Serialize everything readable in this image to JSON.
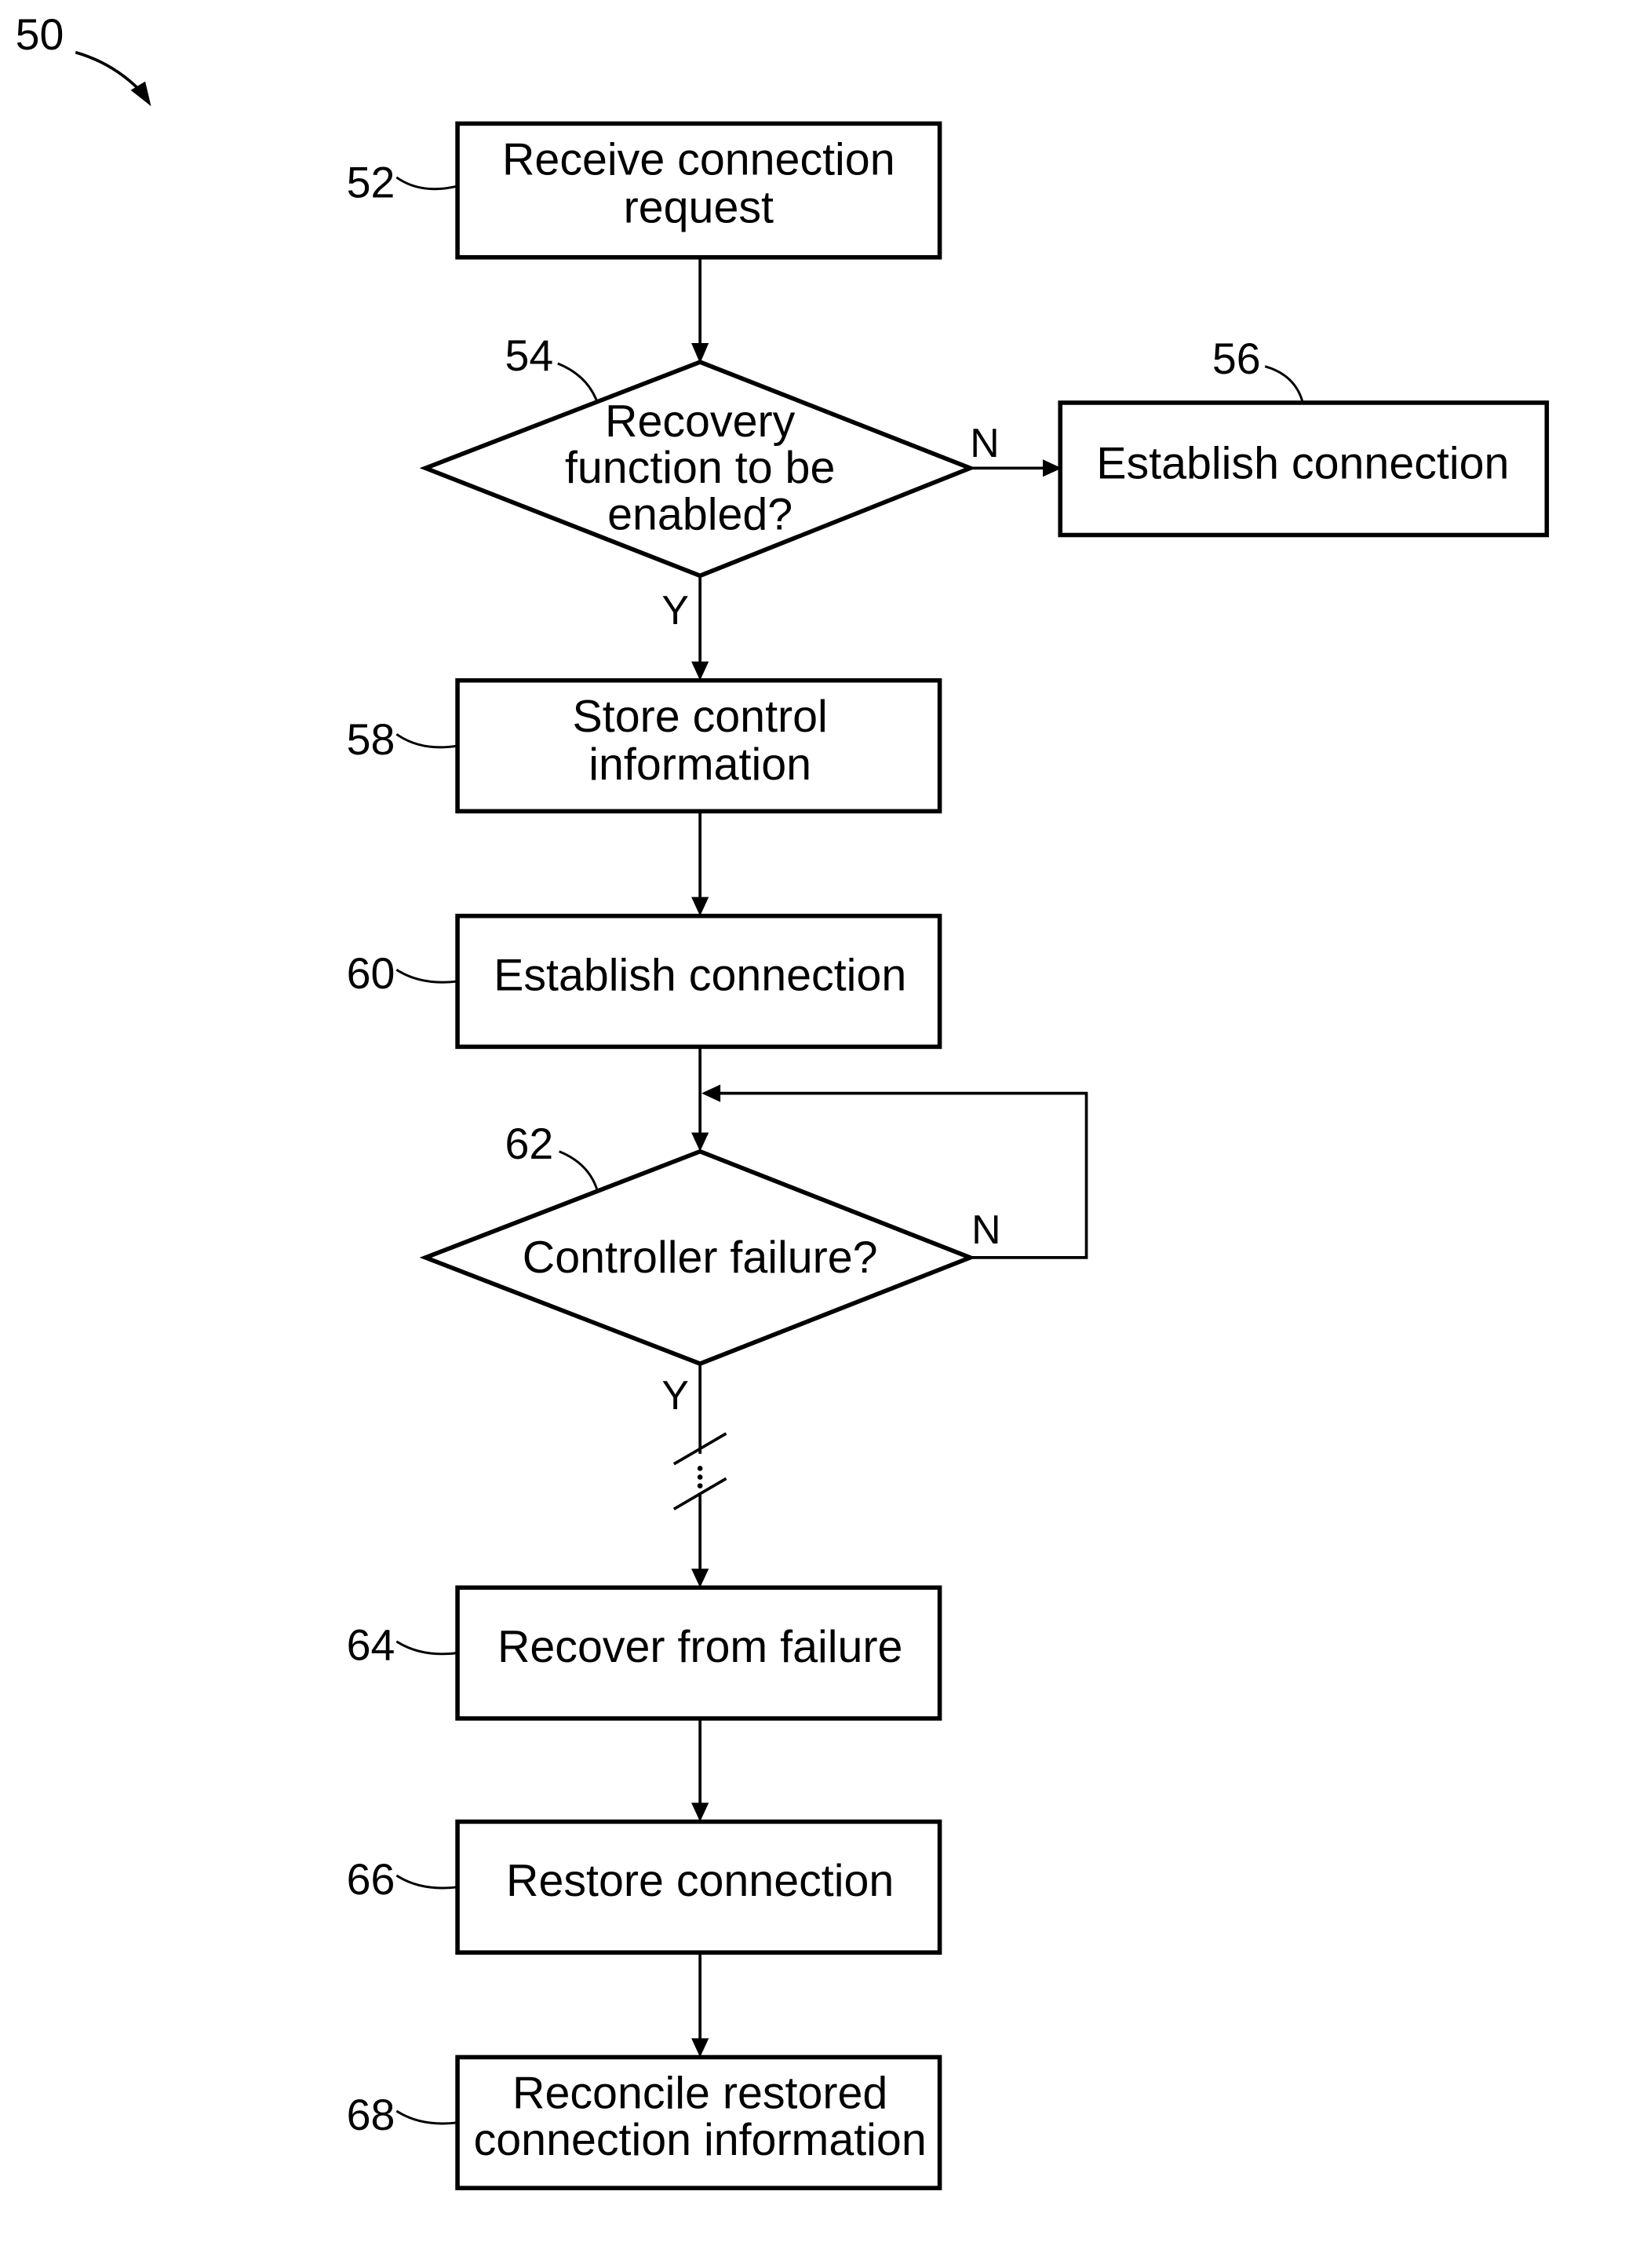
{
  "figure": {
    "reference": "50",
    "steps": [
      {
        "id": "52",
        "type": "process",
        "lines": [
          "Receive connection",
          "request"
        ]
      },
      {
        "id": "54",
        "type": "decision",
        "lines": [
          "Recovery",
          "function to be",
          "enabled?"
        ]
      },
      {
        "id": "56",
        "type": "process",
        "lines": [
          "Establish connection"
        ]
      },
      {
        "id": "58",
        "type": "process",
        "lines": [
          "Store control",
          "information"
        ]
      },
      {
        "id": "60",
        "type": "process",
        "lines": [
          "Establish connection"
        ]
      },
      {
        "id": "62",
        "type": "decision",
        "lines": [
          "Controller failure?"
        ]
      },
      {
        "id": "64",
        "type": "process",
        "lines": [
          "Recover from failure"
        ]
      },
      {
        "id": "66",
        "type": "process",
        "lines": [
          "Restore connection"
        ]
      },
      {
        "id": "68",
        "type": "process",
        "lines": [
          "Reconcile restored",
          "connection information"
        ]
      }
    ],
    "branch_labels": {
      "d54_no": "N",
      "d54_yes": "Y",
      "d62_no": "N",
      "d62_yes": "Y"
    },
    "colors": {
      "ink": "#000000",
      "paper": "#ffffff"
    }
  }
}
